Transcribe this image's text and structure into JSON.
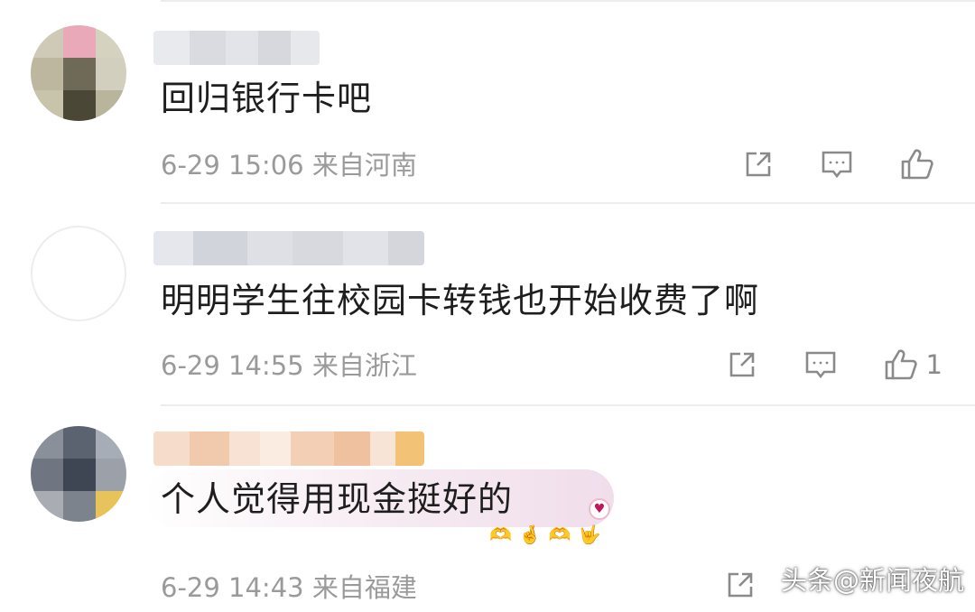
{
  "comments": [
    {
      "text": "回归银行卡吧",
      "meta": "6-29 15:06 来自河南",
      "actions": {
        "share_icon": "share-icon",
        "comment_icon": "comment-icon",
        "like_icon": "thumbs-up-icon",
        "like_count": ""
      }
    },
    {
      "text": "明明学生往校园卡转钱也开始收费了啊",
      "meta": "6-29 14:55 来自浙江",
      "actions": {
        "share_icon": "share-icon",
        "comment_icon": "comment-icon",
        "like_icon": "thumbs-up-icon",
        "like_count": "1"
      }
    },
    {
      "text": "个人觉得用现金挺好的",
      "meta": "6-29 14:43 来自福建",
      "actions": {
        "share_icon": "share-icon"
      },
      "emoji_strip": [
        "🫶",
        "🤞",
        "🫶",
        "🤟"
      ]
    }
  ],
  "watermark": "头条@新闻夜航",
  "colors": {
    "meta_gray": "#9a9a9a",
    "text_dark": "#1e1e1e",
    "divider": "#ececec",
    "bubble_pink": "#f0deeb"
  }
}
